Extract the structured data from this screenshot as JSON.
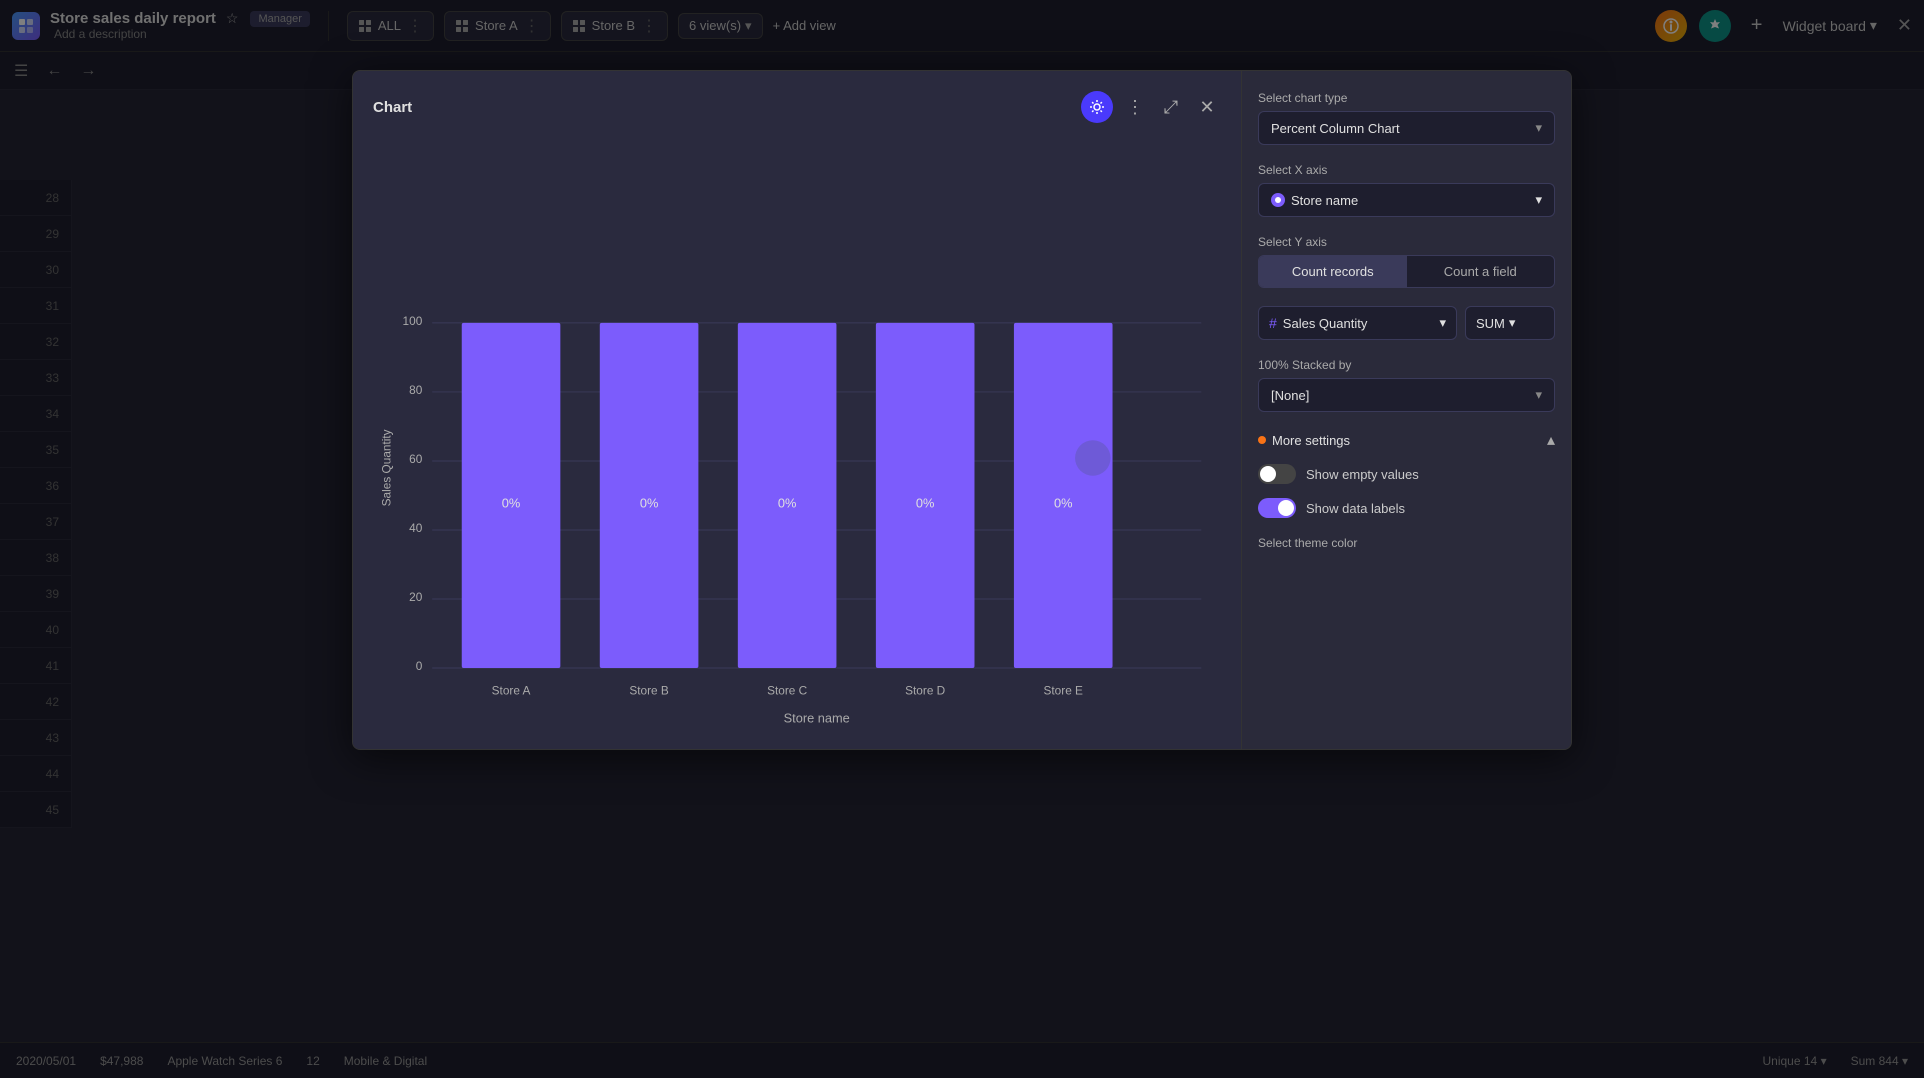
{
  "app": {
    "title": "Store sales daily report",
    "description": "Add a description",
    "badge": "Manager"
  },
  "topbar": {
    "views": [
      {
        "label": "ALL",
        "icon": "grid"
      },
      {
        "label": "Store A",
        "icon": "grid"
      },
      {
        "label": "Store B",
        "icon": "grid"
      }
    ],
    "views_count": "6 view(s)",
    "add_view": "+ Add view",
    "widget_board": "Widget board"
  },
  "modal": {
    "title": "Chart",
    "chart_type_label": "Select chart type",
    "chart_type_value": "Percent Column Chart",
    "x_axis_label": "Select X axis",
    "x_axis_value": "Store name",
    "y_axis_label": "Select Y axis",
    "y_axis_btn1": "Count records",
    "y_axis_btn2": "Count a field",
    "field_name": "Sales Quantity",
    "aggregation": "SUM",
    "stacked_label": "100% Stacked by",
    "stacked_value": "[None]",
    "more_settings": "More settings",
    "show_empty": "Show empty values",
    "show_labels": "Show data labels",
    "theme_color": "Select theme color"
  },
  "chart": {
    "y_label": "Sales Quantity",
    "x_label": "Store name",
    "y_ticks": [
      0,
      20,
      40,
      60,
      80,
      100
    ],
    "bars": [
      {
        "label": "Store A",
        "value": 100,
        "percent": "0%"
      },
      {
        "label": "Store B",
        "value": 100,
        "percent": "0%"
      },
      {
        "label": "Store C",
        "value": 100,
        "percent": "0%"
      },
      {
        "label": "Store D",
        "value": 100,
        "percent": "0%"
      },
      {
        "label": "Store E",
        "value": 100,
        "percent": "0%"
      }
    ],
    "bar_color": "#7c5cfc"
  },
  "row_numbers": [
    28,
    29,
    30,
    31,
    32,
    33,
    34,
    35,
    36,
    37,
    38,
    39,
    40,
    41,
    42,
    43,
    44,
    45
  ],
  "bottom_bar": {
    "date": "2020/05/01",
    "amount": "$47,988",
    "product": "Apple Watch Series 6",
    "qty": "12",
    "category": "Mobile & Digital",
    "unique": "Unique 14",
    "sum": "Sum 844"
  }
}
